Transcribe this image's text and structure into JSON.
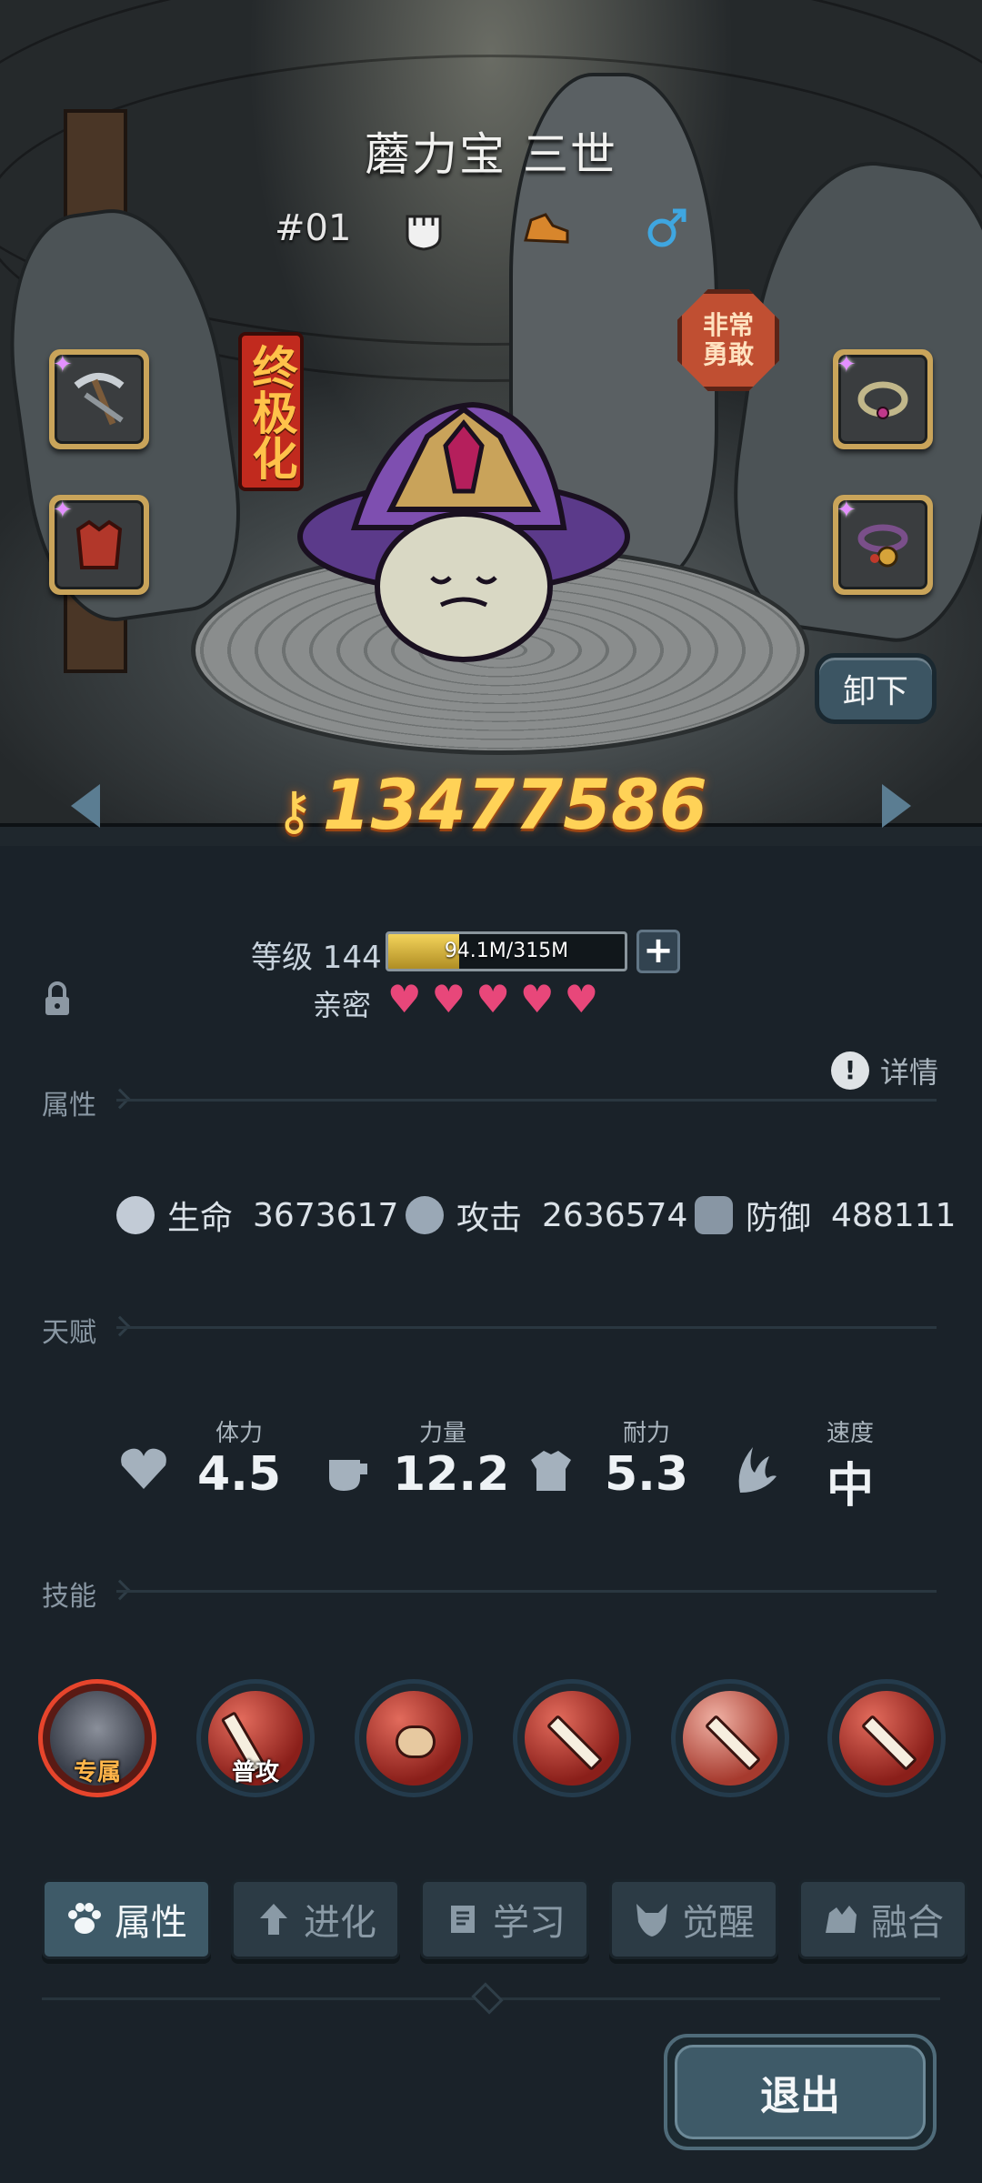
{
  "hero": {
    "name": "蘑力宝 三世",
    "number": "#01",
    "class_icons": [
      "fist-icon",
      "boot-icon",
      "male-icon"
    ],
    "ultimate_tag": "终极化",
    "trait_badge": "非常勇敢",
    "power": "13477586"
  },
  "equipment": {
    "left": [
      "pickaxe-icon",
      "armor-icon"
    ],
    "right": [
      "ring-icon",
      "bell-collar-icon"
    ]
  },
  "unequip_label": "卸下",
  "level": {
    "label": "等级 144",
    "xp_text": "94.1M/315M",
    "xp_current": 94.1,
    "xp_max": 315
  },
  "intimacy": {
    "label": "亲密",
    "hearts": 5
  },
  "detail_label": "详情",
  "sections": {
    "attributes": "属性",
    "talents": "天赋",
    "skills": "技能"
  },
  "stats": [
    {
      "label": "生命",
      "value": "3673617"
    },
    {
      "label": "攻击",
      "value": "2636574"
    },
    {
      "label": "防御",
      "value": "488111"
    }
  ],
  "talents": [
    {
      "label": "体力",
      "value": "4.5"
    },
    {
      "label": "力量",
      "value": "12.2"
    },
    {
      "label": "耐力",
      "value": "5.3"
    },
    {
      "label": "速度",
      "value": "中"
    }
  ],
  "skills": [
    {
      "label": "专属"
    },
    {
      "label": "普攻"
    },
    {
      "label": ""
    },
    {
      "label": ""
    },
    {
      "label": ""
    },
    {
      "label": ""
    }
  ],
  "tabs": [
    "属性",
    "进化",
    "学习",
    "觉醒",
    "融合"
  ],
  "exit_label": "退出",
  "colors": {
    "accent_gold": "#ffd257",
    "panel_bg": "#1a2229",
    "heart": "#e8477a",
    "tab_active": "#3e5a68"
  }
}
